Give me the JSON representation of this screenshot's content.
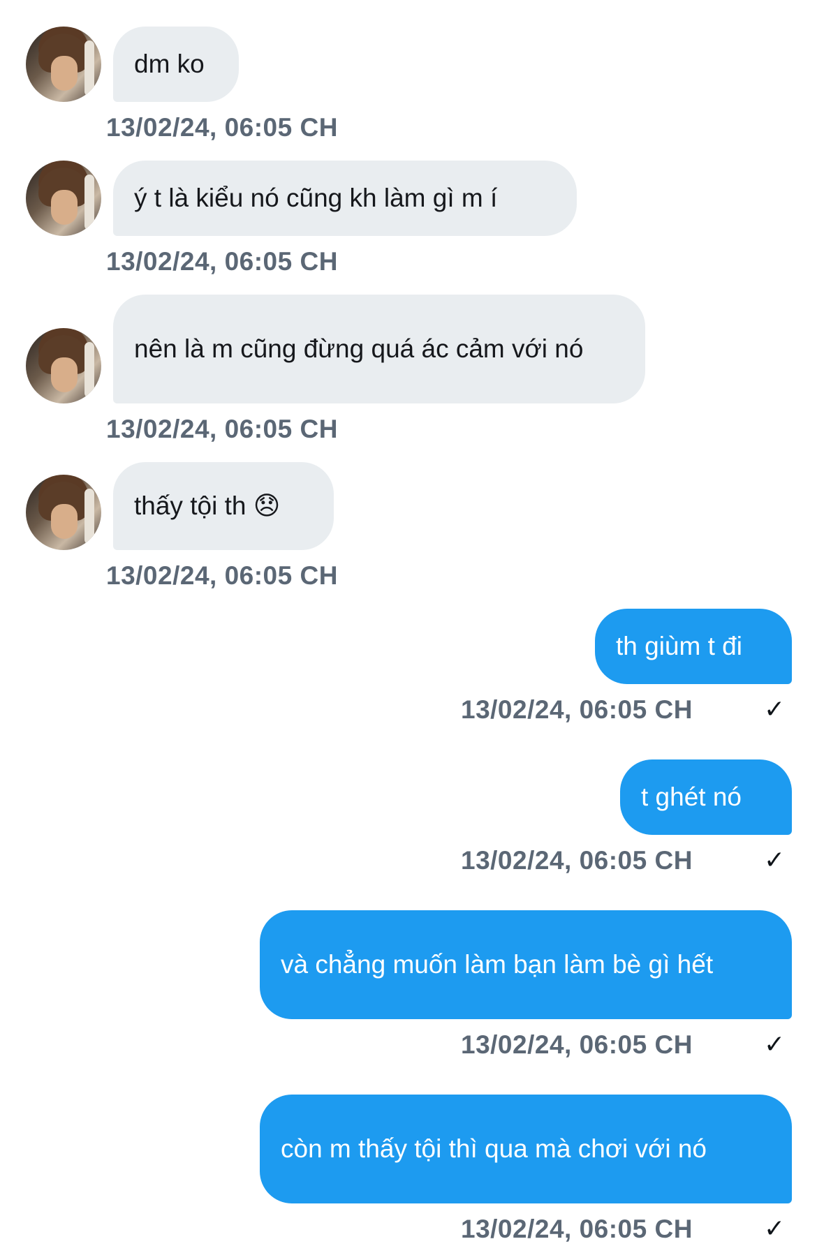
{
  "messages": [
    {
      "direction": "incoming",
      "text": "dm ko",
      "time": "13/02/24, 06:05 CH"
    },
    {
      "direction": "incoming",
      "text": "ý t là kiểu nó cũng kh làm gì m í",
      "time": "13/02/24, 06:05 CH"
    },
    {
      "direction": "incoming",
      "text": "nên là m cũng đừng quá ác cảm với nó",
      "time": "13/02/24, 06:05 CH"
    },
    {
      "direction": "incoming",
      "text": "thấy tội th 😞",
      "time": "13/02/24, 06:05 CH"
    },
    {
      "direction": "outgoing",
      "text": "th giùm t đi",
      "time": "13/02/24, 06:05 CH",
      "status": "✓"
    },
    {
      "direction": "outgoing",
      "text": "t ghét nó",
      "time": "13/02/24, 06:05 CH",
      "status": "✓"
    },
    {
      "direction": "outgoing",
      "text": "và chẳng muốn làm bạn làm bè gì hết",
      "time": "13/02/24, 06:05 CH",
      "status": "✓"
    },
    {
      "direction": "outgoing",
      "text": "còn m thấy tội thì qua mà chơi với nó",
      "time": "13/02/24, 06:05 CH",
      "status": "✓"
    }
  ],
  "colors": {
    "incoming_bubble": "#e9edf0",
    "outgoing_bubble": "#1d9bf0",
    "timestamp": "#5b6775"
  },
  "icons": {
    "avatar": "contact-avatar",
    "status": "sent-check-icon"
  }
}
